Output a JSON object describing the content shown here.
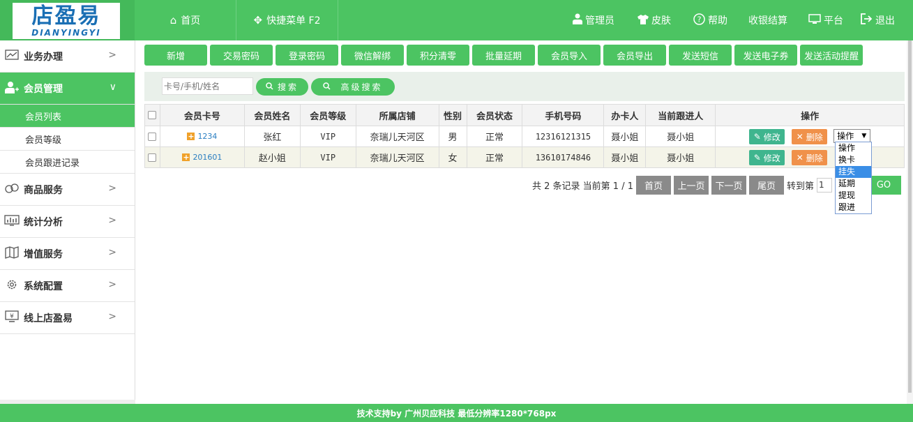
{
  "logo": {
    "cn": "店盈易",
    "en": "DIANYINGYI"
  },
  "topnav": {
    "home": "首页",
    "quick": "快捷菜单 F2",
    "admin": "管理员",
    "skin": "皮肤",
    "help": "帮助",
    "cashier": "收银结算",
    "platform": "平台",
    "logout": "退出"
  },
  "sidebar": {
    "items": [
      {
        "label": "业务办理"
      },
      {
        "label": "会员管理"
      },
      {
        "label": "商品服务"
      },
      {
        "label": "统计分析"
      },
      {
        "label": "增值服务"
      },
      {
        "label": "系统配置"
      },
      {
        "label": "线上店盈易"
      }
    ],
    "sub": [
      "会员列表",
      "会员等级",
      "会员跟进记录"
    ]
  },
  "toolbar": [
    "新增",
    "交易密码",
    "登录密码",
    "微信解绑",
    "积分清零",
    "批量延期",
    "会员导入",
    "会员导出",
    "发送短信",
    "发送电子券",
    "发送活动提醒"
  ],
  "search": {
    "placeholder": "卡号/手机/姓名",
    "search_label": "搜索",
    "advanced_label": "高级搜索"
  },
  "table": {
    "headers": [
      "会员卡号",
      "会员姓名",
      "会员等级",
      "所属店铺",
      "性别",
      "会员状态",
      "手机号码",
      "办卡人",
      "当前跟进人",
      "操作"
    ],
    "rows": [
      {
        "card": "1234",
        "name": "张红",
        "level": "VIP",
        "store": "奈瑞儿天河区",
        "gender": "男",
        "status": "正常",
        "phone": "12316121315",
        "issuer": "聂小姐",
        "follower": "聂小姐"
      },
      {
        "card": "201601",
        "name": "赵小姐",
        "level": "VIP",
        "store": "奈瑞儿天河区",
        "gender": "女",
        "status": "正常",
        "phone": "13610174846",
        "issuer": "聂小姐",
        "follower": "聂小姐"
      }
    ],
    "edit_label": "修改",
    "delete_label": "删除",
    "op_select_value": "操作"
  },
  "dropdown": {
    "options": [
      "操作",
      "换卡",
      "挂失",
      "延期",
      "提现",
      "跟进"
    ],
    "highlighted": "挂失"
  },
  "pager": {
    "summary": "共 2 条记录 当前第 1 / 1",
    "first": "首页",
    "prev": "上一页",
    "next": "下一页",
    "last": "尾页",
    "goto_label": "转到第",
    "goto_value": "1",
    "go": "GO"
  },
  "footer": "技术支持by 广州贝应科技    最低分辨率1280*768px",
  "colors": {
    "brand": "#4cc462",
    "edit": "#3fb58e",
    "delete": "#f0914a",
    "link": "#2a7ec1"
  }
}
